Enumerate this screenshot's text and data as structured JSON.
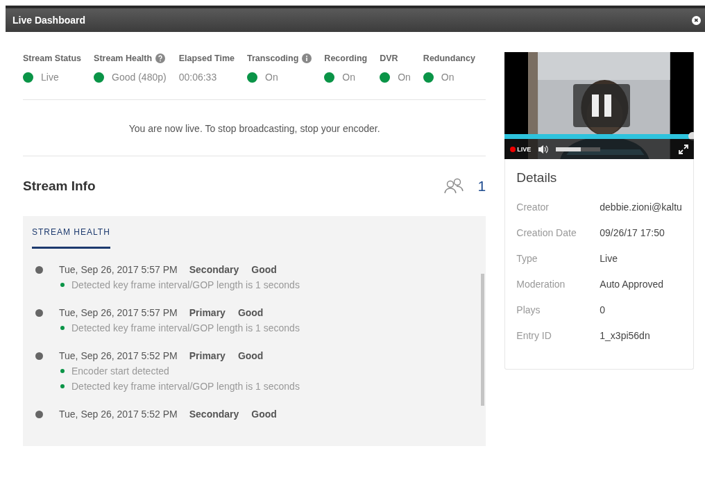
{
  "window": {
    "title": "Live Dashboard",
    "close_icon": "✖"
  },
  "status": [
    {
      "label": "Stream Status",
      "kind": "plain",
      "value": "Live"
    },
    {
      "label": "Stream Health",
      "kind": "help",
      "value": "Good (480p)"
    },
    {
      "label": "Elapsed Time",
      "kind": "timer",
      "value": "00:06:33"
    },
    {
      "label": "Transcoding",
      "kind": "info",
      "value": "On"
    },
    {
      "label": "Recording",
      "kind": "plain",
      "value": "On"
    },
    {
      "label": "DVR",
      "kind": "plain",
      "value": "On"
    },
    {
      "label": "Redundancy",
      "kind": "plain",
      "value": "On"
    }
  ],
  "message": "You are now live. To stop broadcasting, stop your encoder.",
  "stream_info": {
    "title": "Stream Info",
    "viewers": "1",
    "tabs": [
      {
        "label": "STREAM HEALTH",
        "selected": true
      }
    ],
    "events": [
      {
        "time": "Tue, Sep 26, 2017 5:57 PM",
        "source": "Secondary",
        "health": "Good",
        "details": [
          "Detected key frame interval/GOP length is 1 seconds"
        ]
      },
      {
        "time": "Tue, Sep 26, 2017 5:57 PM",
        "source": "Primary",
        "health": "Good",
        "details": [
          "Detected key frame interval/GOP length is 1 seconds"
        ]
      },
      {
        "time": "Tue, Sep 26, 2017 5:52 PM",
        "source": "Primary",
        "health": "Good",
        "details": [
          "Encoder start detected",
          "Detected key frame interval/GOP length is 1 seconds"
        ]
      },
      {
        "time": "Tue, Sep 26, 2017 5:52 PM",
        "source": "Secondary",
        "health": "Good"
      }
    ]
  },
  "player": {
    "live_label": "LIVE",
    "progress": {
      "level": 1
    },
    "volume": {
      "level": 0.55
    }
  },
  "details": {
    "title": "Details",
    "rows": [
      {
        "label": "Creator",
        "value": "debbie.zioni@kaltu"
      },
      {
        "label": "Creation Date",
        "value": "09/26/17 17:50"
      },
      {
        "label": "Type",
        "value": "Live"
      },
      {
        "label": "Moderation",
        "value": "Auto Approved"
      },
      {
        "label": "Plays",
        "value": "0"
      },
      {
        "label": "Entry ID",
        "value": "1_x3pi56dn"
      }
    ]
  }
}
